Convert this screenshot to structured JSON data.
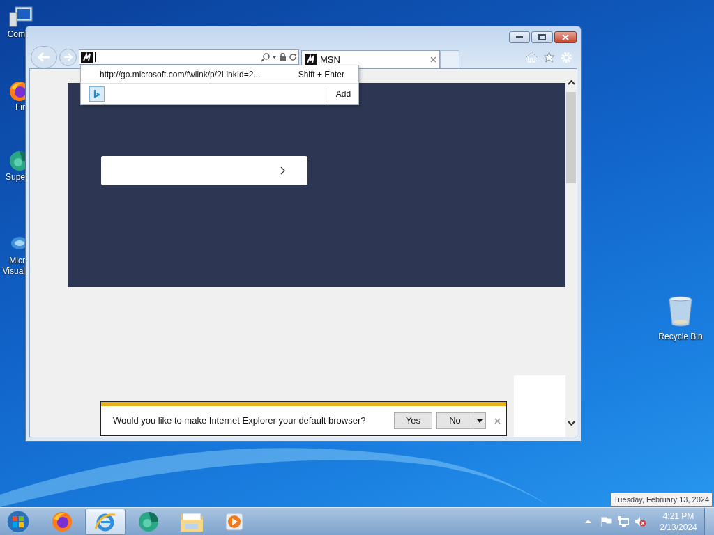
{
  "desktop_icons": [
    {
      "kind": "computer",
      "lines": [
        "Com"
      ]
    },
    {
      "kind": "firefox",
      "lines": [
        "Fir"
      ]
    },
    {
      "kind": "globe",
      "lines": [
        "Supe"
      ]
    },
    {
      "kind": "visual",
      "lines": [
        "Micr",
        "Visual"
      ]
    }
  ],
  "recycle_bin": {
    "kind": "trash",
    "label": "Recycle Bin"
  },
  "browser": {
    "tabs": [
      {
        "label": "MSN",
        "selected": true
      }
    ],
    "address_suggestion": {
      "url": "http://go.microsoft.com/fwlink/p/?LinkId=2...",
      "shortcut": "Shift + Enter",
      "add_label": "Add"
    },
    "notification": {
      "message": "Would you like to make Internet Explorer your default browser?",
      "buttons": [
        "Yes",
        "No"
      ]
    }
  },
  "taskbar": {
    "items": [
      {
        "kind": "firefox",
        "selected": false
      },
      {
        "kind": "ie",
        "selected": true
      },
      {
        "kind": "globe",
        "selected": false
      },
      {
        "kind": "folder",
        "selected": false
      },
      {
        "kind": "media",
        "selected": false
      }
    ],
    "clock": {
      "time": "4:21 PM",
      "date": "2/13/2024"
    },
    "tooltip": "Tuesday, February 13, 2024"
  }
}
